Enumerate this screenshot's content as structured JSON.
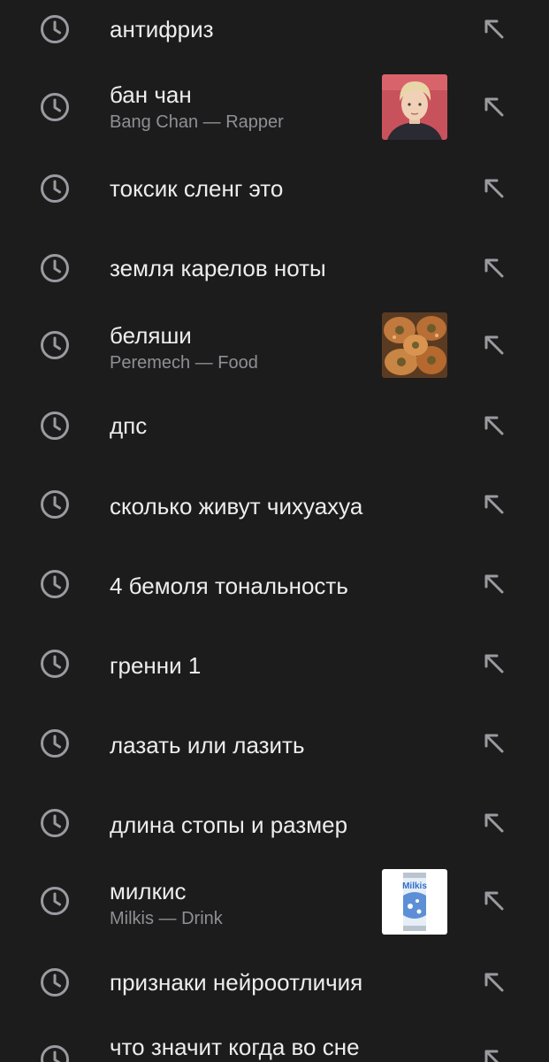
{
  "colors": {
    "background": "#1c1c1d",
    "title_text": "#ededed",
    "subtitle_text": "#8f8f95",
    "icon": "#9a9aa0"
  },
  "icons": {
    "history": "clock-icon",
    "fill_query": "arrow-up-left-icon"
  },
  "history": [
    {
      "title": "антифриз"
    },
    {
      "title": "бан чан",
      "subtitle": "Bang Chan — Rapper",
      "thumbnail": "person-photo"
    },
    {
      "title": "токсик сленг это"
    },
    {
      "title": "земля карелов ноты"
    },
    {
      "title": "беляши",
      "subtitle": "Peremech — Food",
      "thumbnail": "food-photo"
    },
    {
      "title": "дпс"
    },
    {
      "title": "сколько живут чихуахуа"
    },
    {
      "title": "4 бемоля тональность"
    },
    {
      "title": "гренни 1"
    },
    {
      "title": "лазать или лазить"
    },
    {
      "title": "длина стопы и размер"
    },
    {
      "title": "милкис",
      "subtitle": "Milkis — Drink",
      "thumbnail": "drink-can-photo",
      "thumbnail_text": "Milkis"
    },
    {
      "title": "признаки нейроотличия"
    },
    {
      "title": "что значит когда во сне"
    }
  ]
}
